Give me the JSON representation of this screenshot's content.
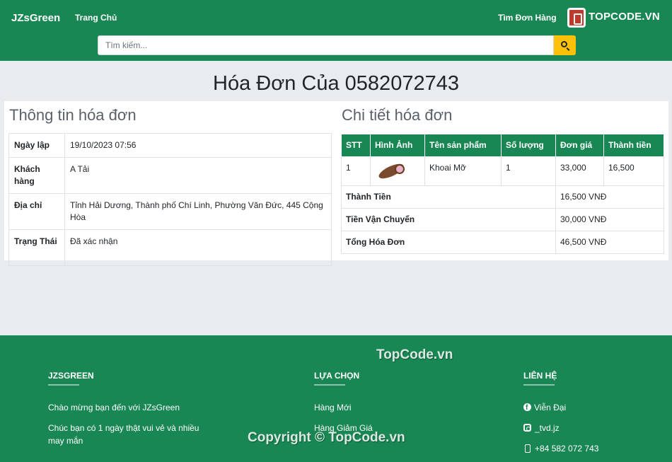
{
  "nav": {
    "brand": "JZsGreen",
    "home": "Trang Chủ",
    "orders": "Tìm Đơn Hàng",
    "logo_text": "TOPCODE.VN"
  },
  "search": {
    "placeholder": "Tìm kiếm..."
  },
  "page_title": "Hóa Đơn Của 0582072743",
  "invoice_info": {
    "title": "Thông tin hóa đơn",
    "rows": [
      {
        "label": "Ngày lập",
        "value": "19/10/2023 07:56"
      },
      {
        "label": "Khách hàng",
        "value": "A Tải"
      },
      {
        "label": "Địa chỉ",
        "value": "Tỉnh Hải Dương, Thành phố Chí Linh, Phường Văn Đức, 445 Cộng Hòa"
      },
      {
        "label": "Trạng Thái",
        "value": "Đã xác nhận"
      }
    ]
  },
  "invoice_detail": {
    "title": "Chi tiết hóa đơn",
    "headers": [
      "STT",
      "Hình Ảnh",
      "Tên sản phẩm",
      "Số lượng",
      "Đơn giá",
      "Thành tiền"
    ],
    "items": [
      {
        "stt": "1",
        "image": "cassava-image",
        "name": "Khoai Mỡ",
        "qty": "1",
        "price": "33,000",
        "total": "16,500"
      }
    ],
    "summary": [
      {
        "label": "Thành Tiền",
        "value": "16,500 VNĐ"
      },
      {
        "label": "Tiền Vận Chuyển",
        "value": "30,000 VNĐ"
      },
      {
        "label": "Tổng Hóa Đơn",
        "value": "46,500 VNĐ"
      }
    ]
  },
  "footer": {
    "col1": {
      "title": "JZSGREEN",
      "lines": [
        "Chào mừng bạn đến với JZsGreen",
        "Chúc bạn có 1 ngày thật vui vẻ và nhiều may mắn"
      ]
    },
    "col2": {
      "title": "LỰA CHỌN",
      "links": [
        "Hàng Mới",
        "Hàng Giảm Giá"
      ]
    },
    "col3": {
      "title": "LIÊN HỆ",
      "facebook": "Viễn Đại",
      "instagram": "_tvd.jz",
      "phone": "+84 582 072 743"
    }
  },
  "watermarks": {
    "top": "TopCode.vn",
    "bottom": "Copyright © TopCode.vn"
  },
  "colors": {
    "primary": "#198754",
    "accent": "#ffc107",
    "background": "#e9ecef"
  }
}
